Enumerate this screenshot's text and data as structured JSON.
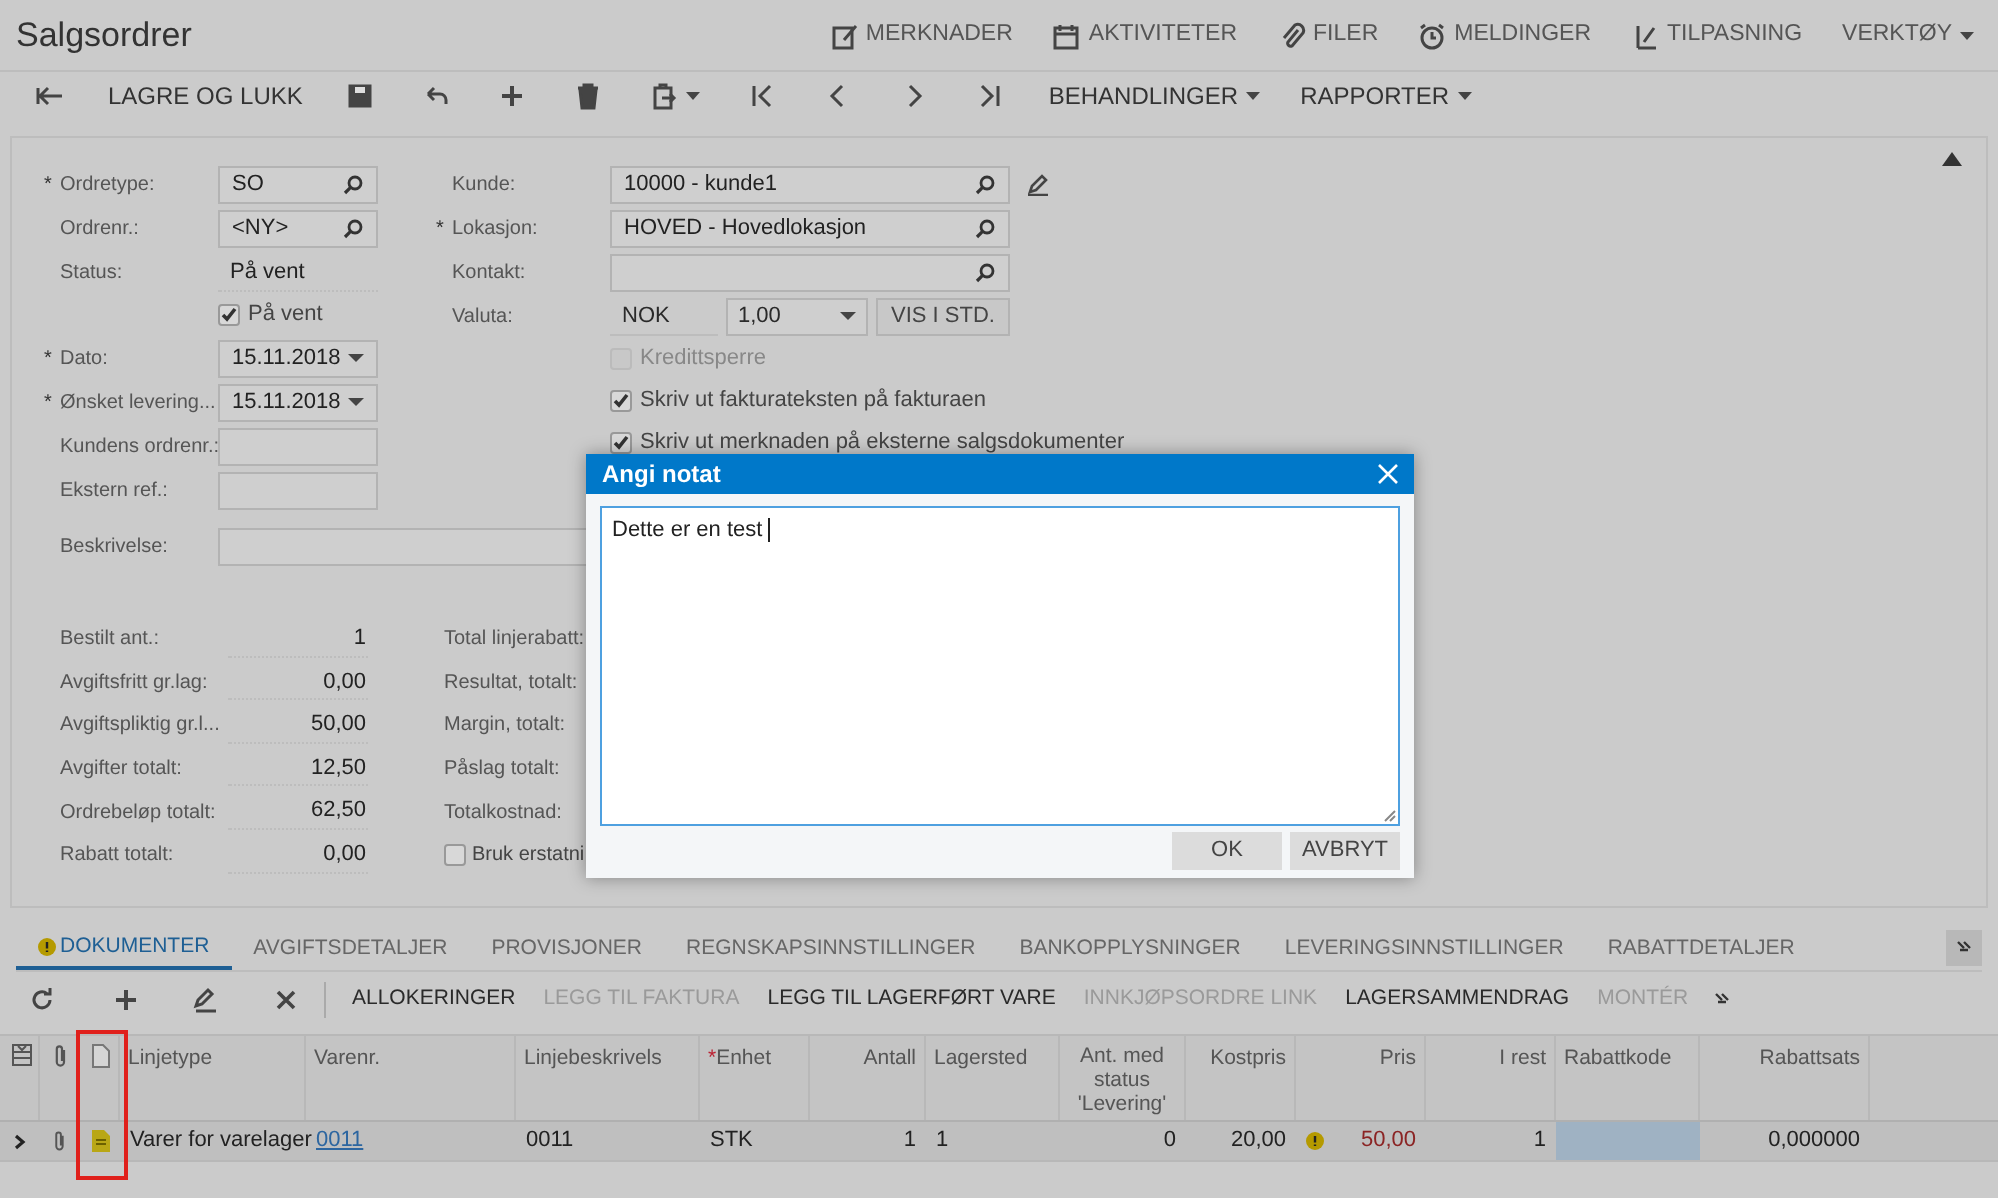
{
  "header": {
    "title": "Salgsordrer",
    "links": [
      "MERKNADER",
      "AKTIVITETER",
      "FILER",
      "MELDINGER",
      "TILPASNING"
    ],
    "menu": "VERKTØY"
  },
  "toolbar": {
    "save_close": "LAGRE OG LUKK",
    "menus": [
      "BEHANDLINGER",
      "RAPPORTER"
    ]
  },
  "form": {
    "left": [
      {
        "kind": "lookup",
        "marker": "*",
        "label": "Ordretype:",
        "value": "SO"
      },
      {
        "kind": "lookup",
        "label": "Ordrenr.:",
        "value": "<NY>"
      },
      {
        "kind": "static",
        "label": "Status:",
        "value": "På vent"
      },
      {
        "kind": "checkbox",
        "label": "På vent",
        "checked": true,
        "disabled": false
      },
      {
        "kind": "date",
        "marker": "*",
        "label": "Dato:",
        "value": "15.11.2018"
      },
      {
        "kind": "date",
        "marker": "*",
        "label": "Ønsket levering...",
        "value": "15.11.2018"
      },
      {
        "kind": "text",
        "label": "Kundens ordrenr.:"
      },
      {
        "kind": "text",
        "label": "Ekstern ref.:"
      }
    ],
    "middle": [
      {
        "kind": "lookup",
        "label": "Kunde:",
        "value": "10000 - kunde1",
        "edit_button": true
      },
      {
        "kind": "lookup",
        "marker": "*",
        "label": "Lokasjon:",
        "value": "HOVED - Hovedlokasjon"
      },
      {
        "kind": "lookup",
        "label": "Kontakt:"
      },
      {
        "kind": "currency",
        "label": "Valuta:",
        "value": "NOK",
        "rate": "1,00",
        "button": "VIS I STD."
      },
      {
        "kind": "checkbox",
        "label": "Kredittsperre",
        "checked": false,
        "disabled": true
      },
      {
        "kind": "checkbox",
        "label": "Skriv ut fakturateksten på fakturaen",
        "checked": true,
        "disabled": false
      },
      {
        "kind": "checkbox",
        "label": "Skriv ut merknaden på eksterne salgsdokumenter",
        "checked": true,
        "disabled": false
      }
    ],
    "description": {
      "label": "Beskrivelse:"
    }
  },
  "summary": {
    "left": [
      {
        "label": "Bestilt ant.:",
        "value": "1"
      },
      {
        "label": "Avgiftsfritt gr.lag:",
        "value": "0,00"
      },
      {
        "label": "Avgiftspliktig gr.l...",
        "value": "50,00"
      },
      {
        "label": "Avgifter totalt:",
        "value": "12,50"
      },
      {
        "label": "Ordrebeløp totalt:",
        "value": "62,50"
      },
      {
        "label": "Rabatt totalt:",
        "value": "0,00"
      }
    ],
    "middle": [
      "Total linjerabatt:",
      "Resultat, totalt:",
      "Margin, totalt:",
      "Påslag totalt:",
      "Totalkostnad:"
    ],
    "checkbox": {
      "label": "Bruk erstatni",
      "checked": false
    }
  },
  "dialog": {
    "title": "Angi notat",
    "text": "Dette er en test",
    "buttons": [
      "OK",
      "AVBRYT"
    ]
  },
  "tabs": [
    {
      "label": "DOKUMENTER",
      "selected": true,
      "warning": true
    },
    {
      "label": "AVGIFTSDETALJER",
      "selected": false,
      "warning": false
    },
    {
      "label": "PROVISJONER",
      "selected": false,
      "warning": false
    },
    {
      "label": "REGNSKAPSINNSTILLINGER",
      "selected": false,
      "warning": false
    },
    {
      "label": "BANKOPPLYSNINGER",
      "selected": false,
      "warning": false
    },
    {
      "label": "LEVERINGSINNSTILLINGER",
      "selected": false,
      "warning": false
    },
    {
      "label": "RABATTDETALJER",
      "selected": false,
      "warning": false
    }
  ],
  "grid_actions": [
    {
      "label": "ALLOKERINGER",
      "disabled": false
    },
    {
      "label": "LEGG TIL FAKTURA",
      "disabled": true
    },
    {
      "label": "LEGG TIL LAGERFØRT VARE",
      "disabled": false
    },
    {
      "label": "INNKJØPSORDRE LINK",
      "disabled": true
    },
    {
      "label": "LAGERSAMMENDRAG",
      "disabled": false
    },
    {
      "label": "MONTÉR",
      "disabled": true
    }
  ],
  "table": {
    "columns": [
      {
        "label": "Linjetype"
      },
      {
        "label": "Varenr."
      },
      {
        "label": "Linjebeskrivels"
      },
      {
        "marker": "*",
        "label": "Enhet"
      },
      {
        "label": "Antall"
      },
      {
        "label": "Lagersted"
      },
      {
        "label": "Ant. med status 'Levering'"
      },
      {
        "label": "Kostpris"
      },
      {
        "label": "Pris"
      },
      {
        "label": "I rest"
      },
      {
        "label": "Rabattkode"
      },
      {
        "label": "Rabattsats"
      }
    ],
    "rows": [
      {
        "active": true,
        "has_note": true,
        "price_warning": true,
        "cells": [
          {
            "text": "Varer for varelager",
            "selected": false
          },
          {
            "text": "0011",
            "selected": false
          },
          {
            "text": "0011",
            "selected": false
          },
          {
            "text": "STK",
            "selected": false
          },
          {
            "text": "1",
            "selected": false
          },
          {
            "text": "1",
            "selected": false
          },
          {
            "text": "0",
            "selected": false
          },
          {
            "text": "20,00",
            "selected": false
          },
          {
            "text": "50,00",
            "selected": false
          },
          {
            "text": "1",
            "selected": false
          },
          {
            "selected": true
          },
          {
            "text": "0,000000",
            "selected": false
          }
        ]
      }
    ]
  }
}
